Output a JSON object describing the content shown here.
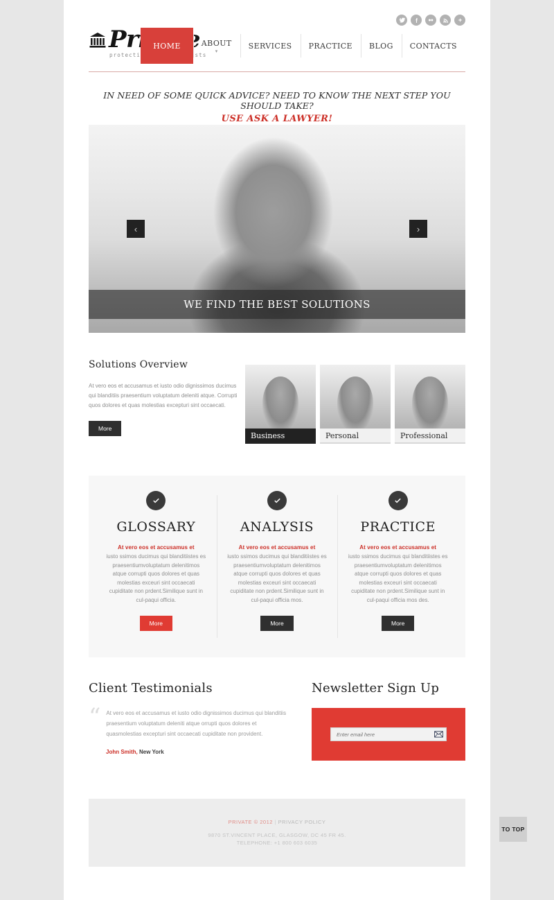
{
  "site": {
    "logo_name": "Private",
    "logo_tagline": "protecting your interests",
    "logo_icon": "bank-columns-icon"
  },
  "social": {
    "items": [
      {
        "name": "twitter-icon",
        "label": "t"
      },
      {
        "name": "facebook-icon",
        "label": "f"
      },
      {
        "name": "flickr-icon",
        "label": "••"
      },
      {
        "name": "rss-icon",
        "label": "rss"
      },
      {
        "name": "google-plus-icon",
        "label": "+"
      }
    ]
  },
  "nav": {
    "items": [
      {
        "label": "HOME",
        "active": true,
        "caret": false
      },
      {
        "label": "ABOUT",
        "active": false,
        "caret": true
      },
      {
        "label": "SERVICES",
        "active": false,
        "caret": false
      },
      {
        "label": "PRACTICE",
        "active": false,
        "caret": false
      },
      {
        "label": "BLOG",
        "active": false,
        "caret": false
      },
      {
        "label": "CONTACTS",
        "active": false,
        "caret": false
      }
    ]
  },
  "tagline": {
    "line1": "IN NEED OF SOME QUICK ADVICE? NEED TO KNOW THE NEXT STEP YOU SHOULD TAKE?",
    "line2": "USE ASK A LAWYER!"
  },
  "slider": {
    "caption": "WE FIND THE BEST SOLUTIONS",
    "prev_label": "‹",
    "next_label": "›"
  },
  "solutions": {
    "title": "Solutions Overview",
    "text": "At vero eos et accusamus et iusto odio dignissimos ducimus qui blanditiis praesentium voluptatum deleniti atque. Corrupti quos dolores et quas molestias excepturi sint occaecati.",
    "more_label": "More",
    "thumbs": [
      {
        "label": "Business",
        "active": true
      },
      {
        "label": "Personal",
        "active": false
      },
      {
        "label": "Professional",
        "active": false
      }
    ]
  },
  "services": {
    "columns": [
      {
        "icon": "check-circle-icon",
        "title": "GLOSSARY",
        "lead": "At vero eos et accusamus et",
        "body": "iusto ssimos ducimus qui blanditiistes es praesentiumvoluptatum delenitimos atque corrupti quos dolores et quas molestias exceuri sint occaecati cupiditate non prdent.Similique sunt in cul-paqui officia.",
        "more_label": "More",
        "more_style": "red"
      },
      {
        "icon": "check-circle-icon",
        "title": "ANALYSIS",
        "lead": "At vero eos et accusamus et",
        "body": "iusto ssimos ducimus qui blanditiistes es praesentiumvoluptatum delenitimos atque corrupti quos dolores et quas molestias exceuri sint occaecati cupiditate non prdent.Similique sunt in cul-paqui officia mos.",
        "more_label": "More",
        "more_style": "dark"
      },
      {
        "icon": "check-circle-icon",
        "title": "PRACTICE",
        "lead": "At vero eos et accusamus et",
        "body": "iusto ssimos ducimus qui blanditiistes es praesentiumvoluptatum delenitimos atque corrupti quos dolores et quas molestias exceuri sint occaecati cupiditate non prdent.Similique sunt in cul-paqui officia mos des.",
        "more_label": "More",
        "more_style": "dark"
      }
    ]
  },
  "testimonials": {
    "title": "Client Testimonials",
    "quote_mark": "“",
    "quote": "At vero eos et accusamus et iusto odio dignissimos ducimus qui blanditiis praesentium voluptatum deleniti atque orrupti quos dolores et quasmolestias excepturi sint occaecati cupiditate non provident.",
    "author_name": "John Smith,",
    "author_location": "New York"
  },
  "newsletter": {
    "title": "Newsletter Sign Up",
    "placeholder": "Enter email here",
    "value": "",
    "submit_icon": "envelope-icon"
  },
  "footer": {
    "brand": "PRIVATE © 2012",
    "separator": "|",
    "privacy": "PRIVACY POLICY",
    "address": "9870 ST.VINCENT PLACE, GLASGOW, DC 45 FR 45.",
    "telephone": "TELEPHONE:  +1 800 603 6035"
  },
  "to_top": {
    "label": "TO TOP"
  },
  "colors": {
    "accent_red": "#d8403a",
    "button_red": "#e03b33",
    "dark": "#2f2f2f",
    "page_bg": "#e7e7e7",
    "panel_bg": "#f7f7f7",
    "footer_bg": "#ededed"
  }
}
